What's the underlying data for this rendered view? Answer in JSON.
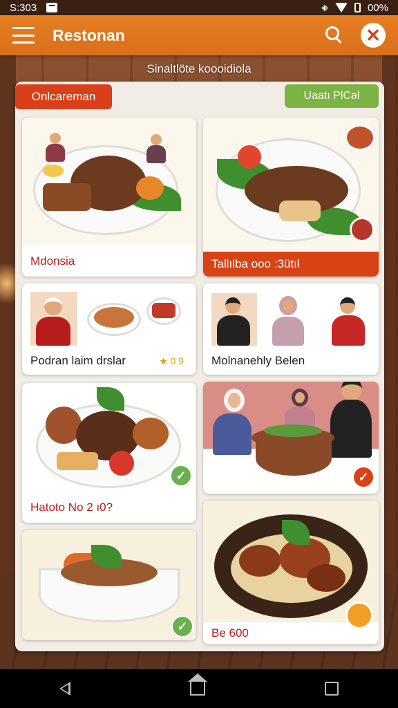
{
  "status_bar": {
    "time": "S:303",
    "battery": "00%"
  },
  "app_bar": {
    "title": "Restonan"
  },
  "subtitle": "Sinaltlöte koooidiola",
  "filters": {
    "left": "Onlcareman",
    "right": "Uaatı PlCal"
  },
  "cards": [
    {
      "label": "Mdonsia"
    },
    {
      "label": "Tallılba ooo :3ütıl"
    },
    {
      "label": "Podran laim drslar",
      "rating": "★ 0 9"
    },
    {
      "label": "Molnanehly Belen"
    },
    {
      "label": "Hatoto No 2 ı0?"
    },
    {
      "label": ""
    },
    {
      "label": ""
    },
    {
      "label": "Be 600"
    }
  ],
  "colors": {
    "accent": "#e67e22",
    "red": "#d84315",
    "green": "#7cb342"
  }
}
